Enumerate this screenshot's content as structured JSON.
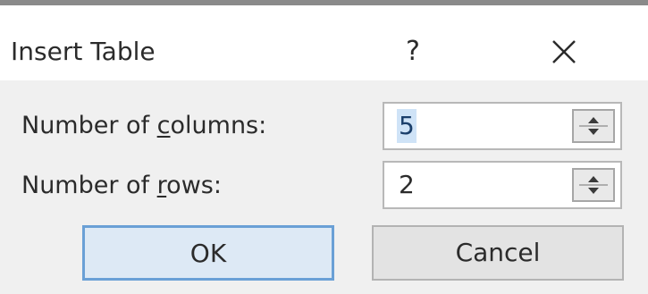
{
  "dialog": {
    "title": "Insert Table",
    "help_label": "?",
    "close_icon": "close-icon"
  },
  "fields": {
    "columns": {
      "label_prefix": "Number of ",
      "label_accesskey": "c",
      "label_suffix": "olumns:",
      "value": "5",
      "spinner_icon": "spinner-arrows-icon"
    },
    "rows": {
      "label_prefix": "Number of ",
      "label_accesskey": "r",
      "label_suffix": "ows:",
      "value": "2",
      "spinner_icon": "spinner-arrows-icon"
    }
  },
  "buttons": {
    "ok_label": "OK",
    "cancel_label": "Cancel"
  }
}
